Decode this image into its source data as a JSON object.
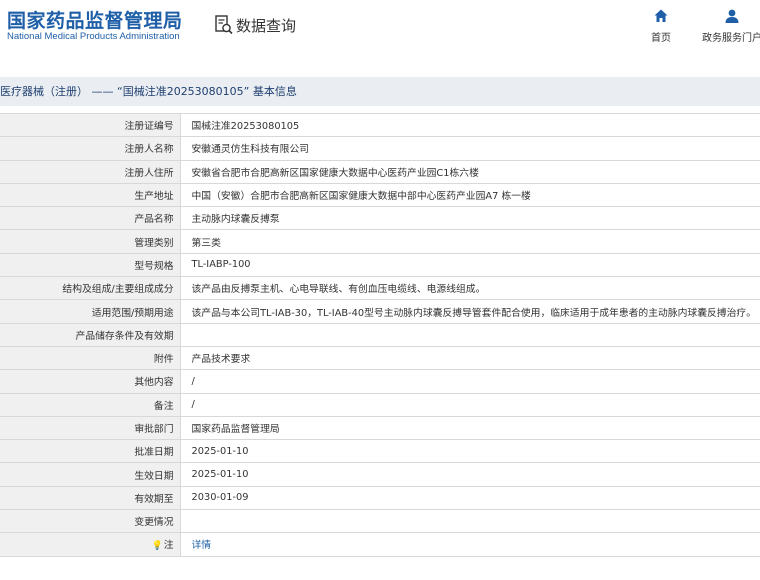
{
  "header": {
    "logo_cn": "国家药品监督管理局",
    "logo_en": "National Medical Products Administration",
    "data_query": "数据查询",
    "nav_home": "首页",
    "nav_gov": "政务服务门户",
    "brand_color": "#1f5fa8"
  },
  "breadcrumb": "医疗器械（注册） —— “国械注准20253080105” 基本信息",
  "rows": [
    {
      "label": "注册证编号",
      "value": "国械注准20253080105"
    },
    {
      "label": "注册人名称",
      "value": "安徽通灵仿生科技有限公司"
    },
    {
      "label": "注册人住所",
      "value": "安徽省合肥市合肥高新区国家健康大数据中心医药产业园C1栋六楼"
    },
    {
      "label": "生产地址",
      "value": "中国（安徽）合肥市合肥高新区国家健康大数据中部中心医药产业园A7 栋一楼"
    },
    {
      "label": "产品名称",
      "value": "主动脉内球囊反搏泵"
    },
    {
      "label": "管理类别",
      "value": "第三类"
    },
    {
      "label": "型号规格",
      "value": "TL-IABP-100"
    },
    {
      "label": "结构及组成/主要组成成分",
      "value": "该产品由反搏泵主机、心电导联线、有创血压电缆线、电源线组成。"
    },
    {
      "label": "适用范围/预期用途",
      "value": "该产品与本公司TL-IAB-30，TL-IAB-40型号主动脉内球囊反搏导管套件配合使用，临床适用于成年患者的主动脉内球囊反搏治疗。"
    },
    {
      "label": "产品储存条件及有效期",
      "value": ""
    },
    {
      "label": "附件",
      "value": "产品技术要求"
    },
    {
      "label": "其他内容",
      "value": "/"
    },
    {
      "label": "备注",
      "value": "/"
    },
    {
      "label": "审批部门",
      "value": "国家药品监督管理局"
    },
    {
      "label": "批准日期",
      "value": "2025-01-10"
    },
    {
      "label": "生效日期",
      "value": "2025-01-10"
    },
    {
      "label": "有效期至",
      "value": "2030-01-09"
    },
    {
      "label": "变更情况",
      "value": ""
    }
  ],
  "note": {
    "label": "注",
    "link": "详情"
  }
}
